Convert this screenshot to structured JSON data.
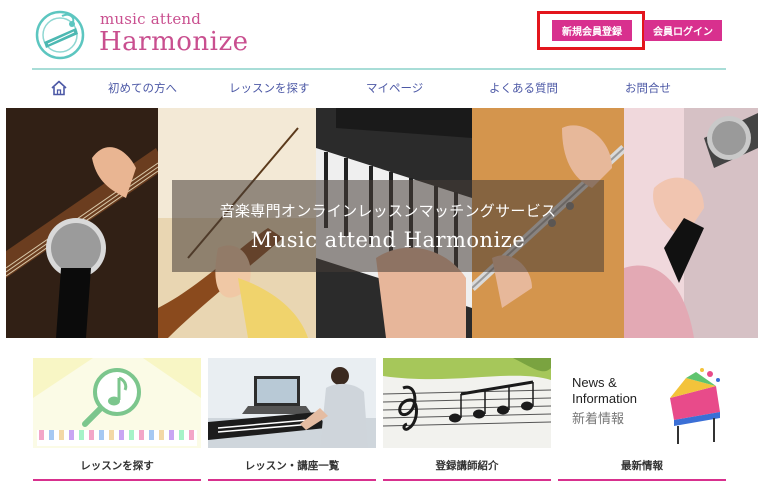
{
  "header": {
    "logo_small": "music attend",
    "logo_big": "Harmonize",
    "register_button": "新規会員登録",
    "login_button": "会員ログイン"
  },
  "nav": {
    "home_icon": "home-icon",
    "items": [
      {
        "label": "初めての方へ"
      },
      {
        "label": "レッスンを探す"
      },
      {
        "label": "マイページ"
      },
      {
        "label": "よくある質問"
      },
      {
        "label": "お問合せ"
      }
    ]
  },
  "hero": {
    "subtitle": "音楽専門オンラインレッスンマッチングサービス",
    "title": "Music attend Harmonize"
  },
  "cards": [
    {
      "label": "レッスンを探す"
    },
    {
      "label": "レッスン・講座一覧"
    },
    {
      "label": "登録講師紹介"
    },
    {
      "label": "最新情報",
      "news_en_line1": "News &",
      "news_en_line2": "Information",
      "news_jp": "新着情報"
    }
  ],
  "colors": {
    "accent": "#d8308e",
    "nav_text": "#4d59a6",
    "rule": "#a8ddd7",
    "highlight": "#e3161d"
  }
}
